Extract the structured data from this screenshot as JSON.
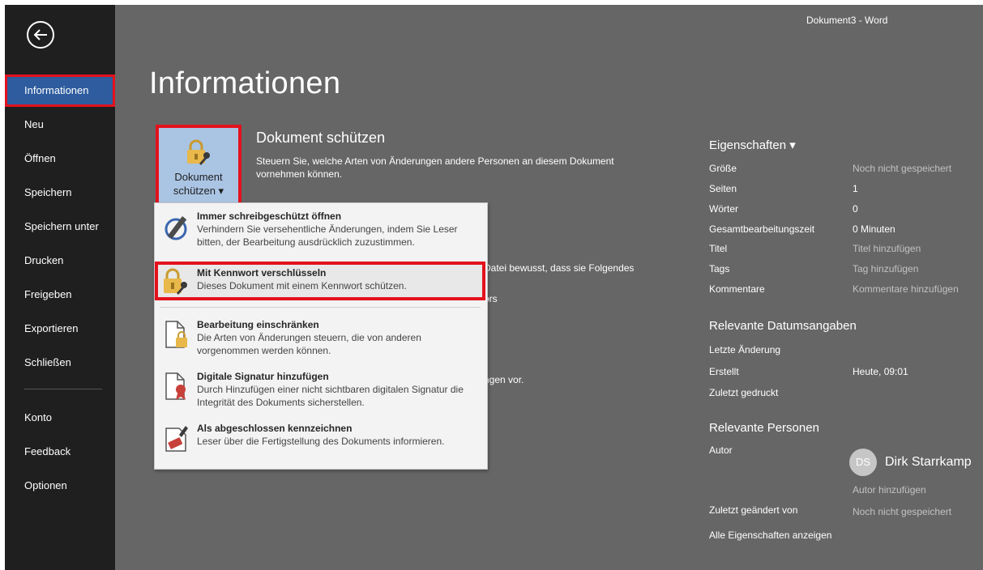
{
  "window": {
    "title": "Dokument3 - Word"
  },
  "sidebar": {
    "items": [
      {
        "label": "Informationen"
      },
      {
        "label": "Neu"
      },
      {
        "label": "Öffnen"
      },
      {
        "label": "Speichern"
      },
      {
        "label": "Speichern unter"
      },
      {
        "label": "Drucken"
      },
      {
        "label": "Freigeben"
      },
      {
        "label": "Exportieren"
      },
      {
        "label": "Schließen"
      },
      {
        "label": "Konto"
      },
      {
        "label": "Feedback"
      },
      {
        "label": "Optionen"
      }
    ]
  },
  "main": {
    "title": "Informationen",
    "protect": {
      "button_line1": "Dokument",
      "button_line2": "schützen ▾",
      "heading": "Dokument schützen",
      "description": "Steuern Sie, welche Arten von Änderungen andere Personen an diesem Dokument vornehmen können."
    },
    "partial_texts": [
      "Datei bewusst, dass sie Folgendes",
      "ors",
      "ngen vor."
    ]
  },
  "dropdown": {
    "items": [
      {
        "title": "Immer schreibgeschützt öffnen",
        "desc": "Verhindern Sie versehentliche Änderungen, indem Sie Leser bitten, der Bearbeitung ausdrücklich zuzustimmen.",
        "icon": "pencil-icon"
      },
      {
        "title": "Mit Kennwort verschlüsseln",
        "desc": "Dieses Dokument mit einem Kennwort schützen.",
        "icon": "lock-key-icon"
      },
      {
        "title": "Bearbeitung einschränken",
        "desc": "Die Arten von Änderungen steuern, die von anderen vorgenommen werden können.",
        "icon": "document-lock-icon"
      },
      {
        "title": "Digitale Signatur hinzufügen",
        "desc": "Durch Hinzufügen einer nicht sichtbaren digitalen Signatur die Integrität des Dokuments sicherstellen.",
        "icon": "document-ribbon-icon"
      },
      {
        "title": "Als abgeschlossen kennzeichnen",
        "desc": "Leser über die Fertigstellung des Dokuments informieren.",
        "icon": "document-stamp-icon"
      }
    ]
  },
  "properties": {
    "header": "Eigenschaften ▾",
    "rows": [
      {
        "label": "Größe",
        "value": "Noch nicht gespeichert"
      },
      {
        "label": "Seiten",
        "value": "1"
      },
      {
        "label": "Wörter",
        "value": "0"
      },
      {
        "label": "Gesamtbearbeitungszeit",
        "value": "0 Minuten"
      },
      {
        "label": "Titel",
        "value": "Titel hinzufügen"
      },
      {
        "label": "Tags",
        "value": "Tag hinzufügen"
      },
      {
        "label": "Kommentare",
        "value": "Kommentare hinzufügen"
      }
    ]
  },
  "dates": {
    "header": "Relevante Datumsangaben",
    "rows": [
      {
        "label": "Letzte Änderung",
        "value": ""
      },
      {
        "label": "Erstellt",
        "value": "Heute, 09:01"
      },
      {
        "label": "Zuletzt gedruckt",
        "value": ""
      }
    ]
  },
  "people": {
    "header": "Relevante Personen",
    "author_label": "Autor",
    "author_initials": "DS",
    "author_name": "Dirk Starrkamp",
    "add_author": "Autor hinzufügen",
    "last_modified_label": "Zuletzt geändert von",
    "last_modified_value": "Noch nicht gespeichert",
    "show_all": "Alle Eigenschaften anzeigen"
  },
  "colors": {
    "sidebar_bg": "#1f1f1f",
    "main_bg": "#666666",
    "selected_nav": "#2e5c9e",
    "highlight_border": "#e3121d",
    "protect_button": "#aac4e3"
  }
}
